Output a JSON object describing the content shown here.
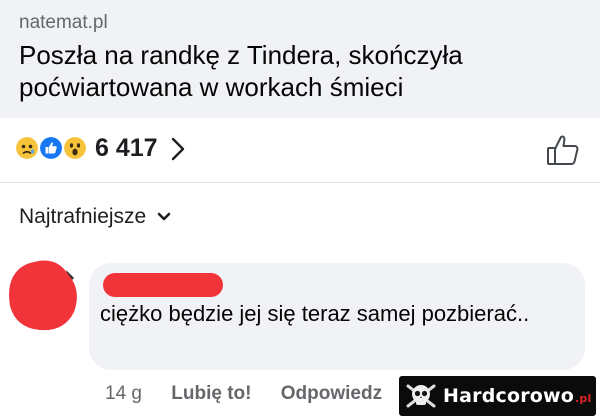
{
  "link_preview": {
    "source": "natemat.pl",
    "title": "Poszła na randkę z Tindera, skończyła poćwiartowana w workach śmieci"
  },
  "reactions": {
    "icons": [
      "sad-reaction-icon",
      "like-reaction-icon",
      "wow-reaction-icon"
    ],
    "count": "6 417"
  },
  "comments": {
    "sort_label": "Najtrafniejsze",
    "items": [
      {
        "name_redacted": true,
        "text": "ciężko będzie jej się teraz samej pozbierać..",
        "time": "14 g",
        "like_label": "Lubię to!",
        "reply_label": "Odpowiedz"
      }
    ]
  },
  "watermark": {
    "text": "Hardcorowo",
    "suffix": ".pl"
  },
  "colors": {
    "preview_bg": "#f0f2f5",
    "bubble_bg": "#f0f2f5",
    "redaction_red": "#f1343a",
    "secondary_text": "#65676b",
    "like_blue": "#1877f2",
    "reaction_yellow": "#f7c33b"
  }
}
